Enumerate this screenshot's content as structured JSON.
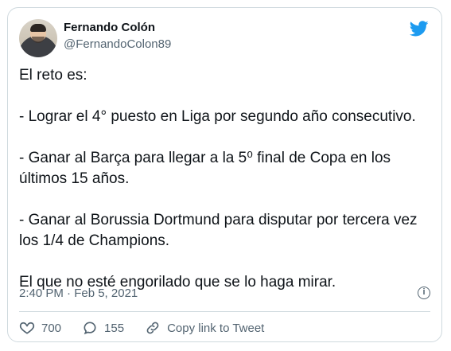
{
  "author": {
    "name": "Fernando Colón",
    "handle": "@FernandoColon89"
  },
  "tweet": {
    "text": "El reto es:\n\n- Lograr el 4° puesto en Liga por segundo año consecutivo.\n\n- Ganar al Barça para llegar a la 5⁰ final de Copa en los últimos 15 años.\n\n- Ganar al Borussia Dortmund para disputar por tercera vez los 1/4 de Champions.\n\nEl que no esté engorilado que se lo haga mirar.",
    "timestamp": "2:40 PM · Feb 5, 2021"
  },
  "actions": {
    "likes": "700",
    "replies": "155",
    "copy_label": "Copy link to Tweet"
  },
  "icons": {
    "brand": "twitter-bird-icon",
    "info": "info-icon",
    "like": "heart-icon",
    "reply": "reply-icon",
    "link": "link-icon"
  },
  "colors": {
    "brand": "#1d9bf0",
    "text": "#0f1419",
    "muted": "#536471",
    "border": "#cfd9de"
  }
}
